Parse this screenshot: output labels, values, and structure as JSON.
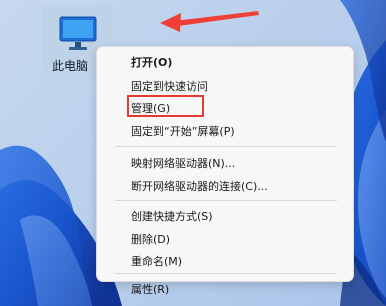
{
  "desktop": {
    "icon_label": "此电脑"
  },
  "context_menu": {
    "open": "打开(O)",
    "pin_quick_access": "固定到快速访问",
    "manage": "管理(G)",
    "pin_start": "固定到“开始”屏幕(P)",
    "map_drive": "映射网络驱动器(N)...",
    "disconnect_drive": "断开网络驱动器的连接(C)...",
    "create_shortcut": "创建快捷方式(S)",
    "delete": "删除(D)",
    "rename": "重命名(M)",
    "properties": "属性(R)"
  },
  "icons": {
    "desktop_icon": "computer-monitor-icon",
    "pointer": "arrow-pointer-icon"
  },
  "colors": {
    "highlight": "#e43b31",
    "arrow": "#ef3f37",
    "wallpaper_blue": "#1e5fd8"
  }
}
